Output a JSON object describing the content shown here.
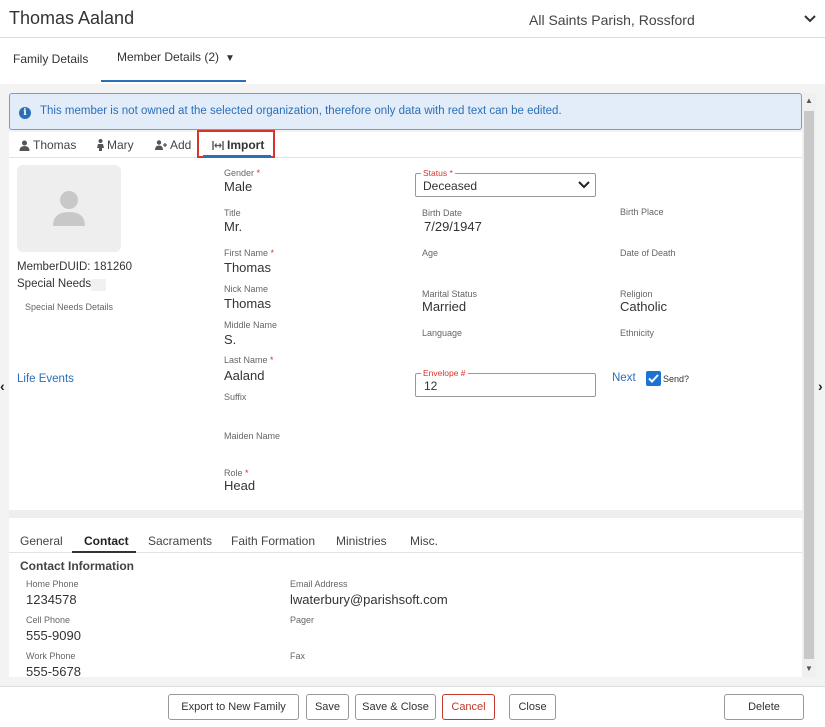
{
  "header": {
    "title": "Thomas Aaland",
    "organization": "All Saints Parish, Rossford"
  },
  "top_tabs": {
    "family": "Family Details",
    "member": "Member Details (2)",
    "active": "member"
  },
  "alert": {
    "icon": "info-icon",
    "text": "This member is not owned at the selected organization, therefore only data with red text can be edited."
  },
  "member_tabs": [
    {
      "label": "Thomas",
      "icon": "person-male-icon"
    },
    {
      "label": "Mary",
      "icon": "person-female-icon"
    },
    {
      "label": "Add",
      "icon": "add-person-icon"
    },
    {
      "label": "Import",
      "icon": "import-icon",
      "active": true
    }
  ],
  "profile": {
    "member_duid": "MemberDUID: 181260",
    "special_needs": "Special Needs",
    "special_needs_details": "Special Needs Details",
    "life_events": "Life Events"
  },
  "fields": {
    "gender": {
      "label": "Gender",
      "required": "*",
      "value": "Male"
    },
    "title": {
      "label": "Title",
      "value": "Mr."
    },
    "first_name": {
      "label": "First Name",
      "required": "*",
      "value": "Thomas"
    },
    "nick_name": {
      "label": "Nick Name",
      "value": "Thomas"
    },
    "middle_name": {
      "label": "Middle Name",
      "value": "S."
    },
    "last_name": {
      "label": "Last Name",
      "required": "*",
      "value": "Aaland"
    },
    "suffix": {
      "label": "Suffix",
      "value": ""
    },
    "maiden_name": {
      "label": "Maiden Name",
      "value": ""
    },
    "role": {
      "label": "Role",
      "required": "*",
      "value": "Head"
    },
    "status": {
      "label": "Status",
      "required": "*",
      "value": "Deceased"
    },
    "birth_date": {
      "label": "Birth Date",
      "value": "7/29/1947"
    },
    "age": {
      "label": "Age",
      "value": ""
    },
    "marital_status": {
      "label": "Marital Status",
      "value": "Married"
    },
    "language": {
      "label": "Language",
      "value": ""
    },
    "envelope": {
      "label": "Envelope #",
      "value": "12"
    },
    "birth_place": {
      "label": "Birth Place",
      "value": ""
    },
    "date_of_death": {
      "label": "Date of Death",
      "value": ""
    },
    "religion": {
      "label": "Religion",
      "value": "Catholic"
    },
    "ethnicity": {
      "label": "Ethnicity",
      "value": ""
    },
    "next_link": "Next",
    "send_label": "Send?",
    "send_checked": true
  },
  "bottom_tabs": {
    "items": [
      "General",
      "Contact",
      "Sacraments",
      "Faith Formation",
      "Ministries",
      "Misc."
    ],
    "active": "Contact"
  },
  "contact": {
    "section_title": "Contact Information",
    "home_phone": {
      "label": "Home Phone",
      "value": "1234578"
    },
    "cell_phone": {
      "label": "Cell Phone",
      "value": "555-9090"
    },
    "work_phone": {
      "label": "Work Phone",
      "value": "555-5678"
    },
    "email": {
      "label": "Email Address",
      "value": "lwaterbury@parishsoft.com"
    },
    "pager": {
      "label": "Pager",
      "value": ""
    },
    "fax": {
      "label": "Fax",
      "value": ""
    }
  },
  "footer": {
    "export": "Export to New Family",
    "save": "Save",
    "save_close": "Save & Close",
    "cancel": "Cancel",
    "close": "Close",
    "delete": "Delete"
  },
  "colors": {
    "accent": "#2a6fb8",
    "required": "#d9332e",
    "alert_bg": "#e3edfa",
    "checkbox": "#1e73d2"
  }
}
